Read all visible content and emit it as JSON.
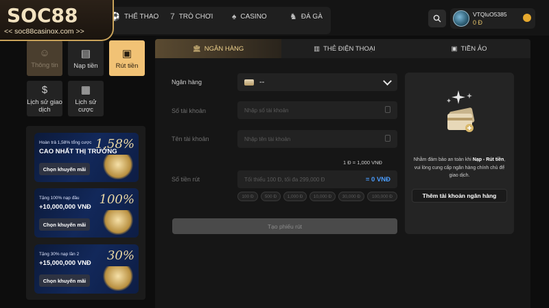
{
  "brand": {
    "logo": "SOC88",
    "url_label": "<< soc88casinox.com >>"
  },
  "nav": [
    {
      "label": "THỂ THAO",
      "icon": "sports-icon"
    },
    {
      "label": "TRÒ CHƠI",
      "icon": "slot-777-icon"
    },
    {
      "label": "CASINO",
      "icon": "cards-icon"
    },
    {
      "label": "ĐÁ GÀ",
      "icon": "rooster-icon"
    }
  ],
  "user": {
    "name": "VTQluO5385",
    "balance": "0 Đ"
  },
  "sidebar": {
    "tiles": [
      {
        "label": "Thông tin",
        "icon": "user-icon"
      },
      {
        "label": "Nạp tiền",
        "icon": "deposit-icon"
      },
      {
        "label": "Rút tiền",
        "icon": "withdraw-icon"
      },
      {
        "label": "Lịch sử giao dịch",
        "icon": "history-icon"
      },
      {
        "label": "Lịch sử cược",
        "icon": "calendar-icon"
      }
    ]
  },
  "promos": [
    {
      "pre": "Hoàn trả 1,58% tổng cược",
      "big": "CAO NHẤT THỊ TRƯỜNG",
      "pct": "1,58%",
      "button": "Chọn khuyến mãi"
    },
    {
      "pre": "Tặng 100% nạp đầu",
      "big": "+10,000,000 VNĐ",
      "pct": "100%",
      "button": "Chọn khuyến mãi"
    },
    {
      "pre": "Tặng 30% nạp lần 2",
      "big": "+15,000,000 VNĐ",
      "pct": "30%",
      "button": "Chọn khuyến mãi"
    }
  ],
  "tabs": [
    {
      "label": "NGÂN HÀNG",
      "icon": "bank-icon",
      "active": true
    },
    {
      "label": "THẺ ĐIỆN THOẠI",
      "icon": "phone-card-icon",
      "active": false
    },
    {
      "label": "TIỀN ẢO",
      "icon": "crypto-icon",
      "active": false
    }
  ],
  "form": {
    "bank_label": "Ngân hàng",
    "bank_value": "--",
    "account_no_label": "Số tài khoản",
    "account_no_placeholder": "Nhập số tài khoản",
    "account_name_label": "Tên tài khoản",
    "account_name_placeholder": "Nhập tên tài khoản",
    "rate": "1 Đ = 1,000 VNĐ",
    "amount_label": "Số tiền rút",
    "amount_placeholder": "Tối thiểu 100 Đ, tối đa 299,000 Đ",
    "amount_eq": "= 0 VNĐ",
    "chips": [
      "100 Đ",
      "500 Đ",
      "1,000 Đ",
      "10,000 Đ",
      "30,000 Đ",
      "100,000 Đ"
    ],
    "submit": "Tạo phiếu rút"
  },
  "info": {
    "text_before": "Nhằm đảm bảo an toàn khi ",
    "text_bold": "Nạp - Rút tiền",
    "text_after": ", vui lòng cung cấp ngân hàng chính chủ để giao dịch.",
    "button": "Thêm tài khoản ngân hàng"
  }
}
